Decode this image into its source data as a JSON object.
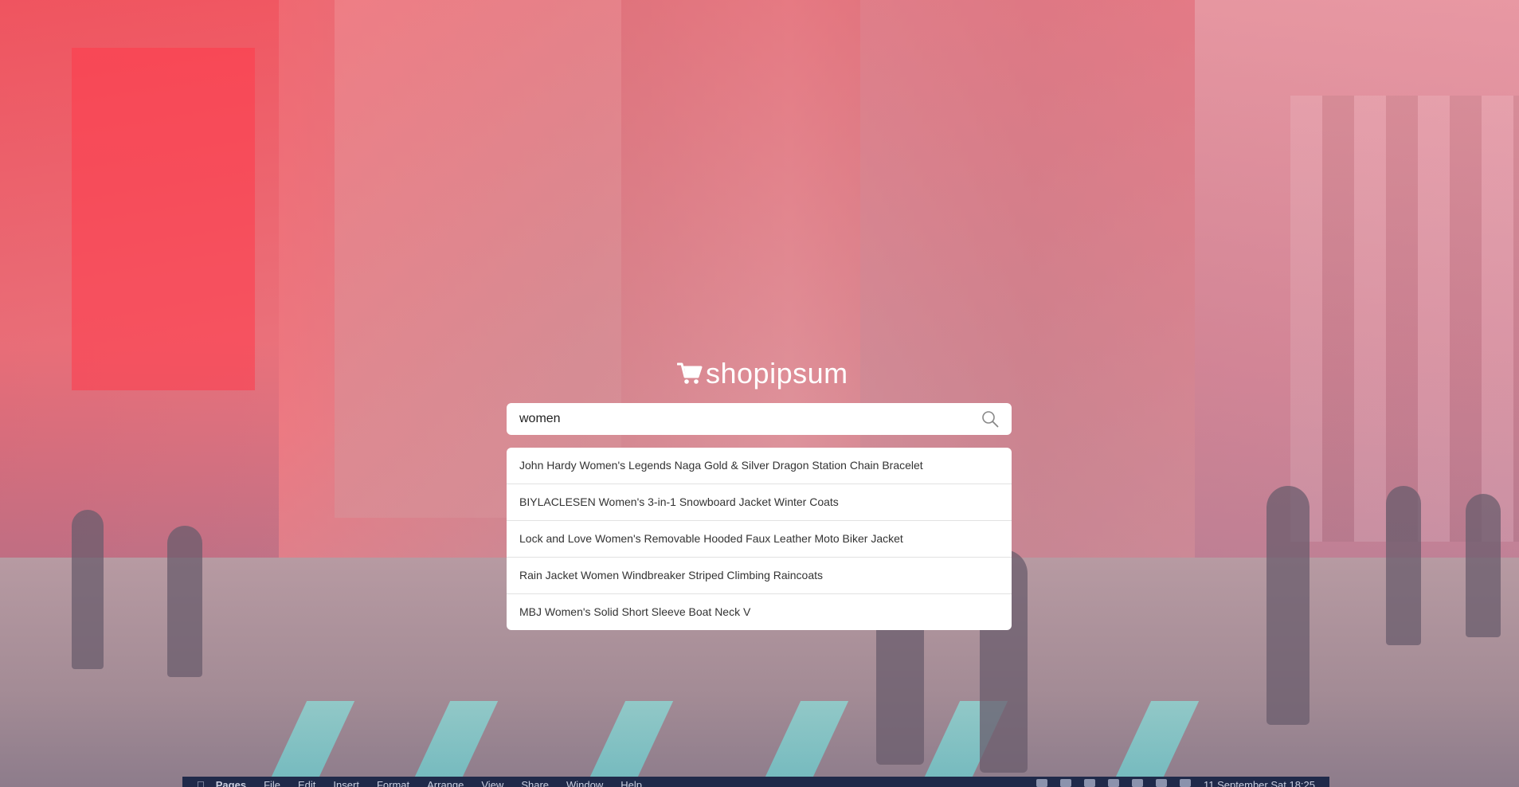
{
  "logo": {
    "icon": "cart-icon",
    "text": "shopipsum"
  },
  "search": {
    "value": "women",
    "placeholder": "",
    "icon": "search-icon"
  },
  "suggestions": [
    "John Hardy Women's Legends Naga Gold & Silver Dragon Station Chain Bracelet",
    "BIYLACLESEN Women's 3-in-1 Snowboard Jacket Winter Coats",
    "Lock and Love Women's Removable Hooded Faux Leather Moto Biker Jacket",
    "Rain Jacket Women Windbreaker Striped Climbing Raincoats",
    "MBJ Women's Solid Short Sleeve Boat Neck V"
  ],
  "menubar": {
    "apple_icon": "apple-icon",
    "app_name": "Pages",
    "items": [
      "File",
      "Edit",
      "Insert",
      "Format",
      "Arrange",
      "View",
      "Share",
      "Window",
      "Help"
    ],
    "datetime": "11 September Sat 18:25"
  },
  "colors": {
    "overlay": "#e4505e",
    "menubar": "#1f2a4a",
    "card": "#ffffff"
  }
}
